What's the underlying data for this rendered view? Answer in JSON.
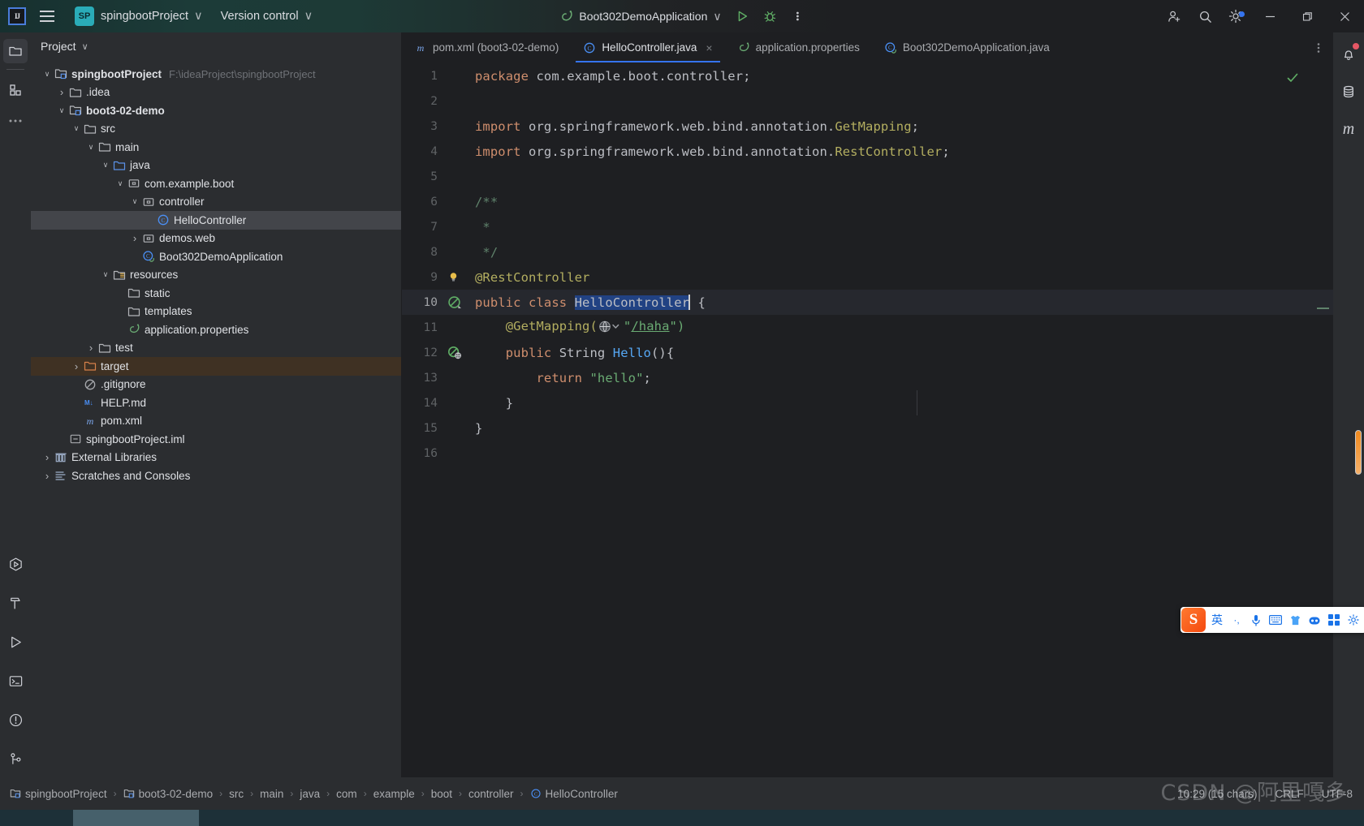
{
  "titlebar": {
    "logo_text": "IJ",
    "project_badge": "SP",
    "project_name": "spingbootProject",
    "version_control": "Version control",
    "run_config": "Boot302DemoApplication",
    "chevron": "∨"
  },
  "left_rail": {
    "items": [
      {
        "name": "project-tool-window",
        "icon": "folder-icon"
      },
      {
        "name": "commit-tool-window",
        "icon": "commit-icon"
      },
      {
        "name": "more-tool-windows",
        "icon": "ellipsis-icon"
      }
    ],
    "bottom_items": [
      {
        "name": "run-tool-window",
        "icon": "run-hex-icon"
      },
      {
        "name": "build-tool-window",
        "icon": "hammer-icon"
      },
      {
        "name": "services-tool-window",
        "icon": "play-icon"
      },
      {
        "name": "terminal-tool-window",
        "icon": "terminal-icon"
      },
      {
        "name": "problems-tool-window",
        "icon": "warning-icon"
      },
      {
        "name": "git-tool-window",
        "icon": "branch-icon"
      }
    ]
  },
  "right_rail": {
    "items": [
      {
        "name": "notifications",
        "icon": "bell-icon"
      },
      {
        "name": "database",
        "icon": "database-icon"
      },
      {
        "name": "maven",
        "icon": "maven-m-icon"
      }
    ]
  },
  "project_panel": {
    "title": "Project",
    "tree": [
      {
        "depth": 0,
        "arrow": "down",
        "icon": "module-icon",
        "label": "spingbootProject",
        "bold": true,
        "path": "F:\\ideaProject\\spingbootProject"
      },
      {
        "depth": 1,
        "arrow": "right",
        "icon": "folder-icon",
        "label": ".idea"
      },
      {
        "depth": 1,
        "arrow": "down",
        "icon": "module-icon",
        "label": "boot3-02-demo",
        "bold": true
      },
      {
        "depth": 2,
        "arrow": "down",
        "icon": "folder-icon",
        "label": "src"
      },
      {
        "depth": 3,
        "arrow": "down",
        "icon": "folder-icon",
        "label": "main"
      },
      {
        "depth": 4,
        "arrow": "down",
        "icon": "source-root-icon",
        "label": "java"
      },
      {
        "depth": 5,
        "arrow": "down",
        "icon": "package-icon",
        "label": "com.example.boot"
      },
      {
        "depth": 6,
        "arrow": "down",
        "icon": "package-icon",
        "label": "controller"
      },
      {
        "depth": 7,
        "arrow": "none",
        "icon": "java-class-icon",
        "label": "HelloController",
        "selected": true
      },
      {
        "depth": 6,
        "arrow": "right",
        "icon": "package-icon",
        "label": "demos.web"
      },
      {
        "depth": 6,
        "arrow": "none",
        "icon": "spring-class-icon",
        "label": "Boot302DemoApplication"
      },
      {
        "depth": 4,
        "arrow": "down",
        "icon": "resources-root-icon",
        "label": "resources"
      },
      {
        "depth": 5,
        "arrow": "none",
        "icon": "folder-icon",
        "label": "static"
      },
      {
        "depth": 5,
        "arrow": "none",
        "icon": "folder-icon",
        "label": "templates"
      },
      {
        "depth": 5,
        "arrow": "none",
        "icon": "spring-file-icon",
        "label": "application.properties"
      },
      {
        "depth": 3,
        "arrow": "right",
        "icon": "folder-icon",
        "label": "test"
      },
      {
        "depth": 2,
        "arrow": "right",
        "icon": "excluded-folder-icon",
        "label": "target",
        "highlight": true
      },
      {
        "depth": 2,
        "arrow": "none",
        "icon": "gitignore-icon",
        "label": ".gitignore"
      },
      {
        "depth": 2,
        "arrow": "none",
        "icon": "markdown-icon",
        "label": "HELP.md"
      },
      {
        "depth": 2,
        "arrow": "none",
        "icon": "maven-m-icon",
        "label": "pom.xml"
      },
      {
        "depth": 1,
        "arrow": "none",
        "icon": "iml-icon",
        "label": "spingbootProject.iml"
      },
      {
        "depth": 0,
        "arrow": "right",
        "icon": "library-icon",
        "label": "External Libraries"
      },
      {
        "depth": 0,
        "arrow": "right",
        "icon": "scratches-icon",
        "label": "Scratches and Consoles"
      }
    ]
  },
  "editor": {
    "tabs": [
      {
        "label": "pom.xml (boot3-02-demo)",
        "icon": "maven-m-icon",
        "active": false,
        "closable": false
      },
      {
        "label": "HelloController.java",
        "icon": "java-class-icon",
        "active": true,
        "closable": true,
        "close_glyph": "×"
      },
      {
        "label": "application.properties",
        "icon": "spring-file-icon",
        "active": false,
        "closable": false
      },
      {
        "label": "Boot302DemoApplication.java",
        "icon": "spring-class-icon",
        "active": false,
        "closable": false
      }
    ],
    "inspection_ok": true,
    "lines": [
      {
        "n": 1,
        "gutter": null,
        "segments": [
          {
            "t": "package ",
            "c": "kw"
          },
          {
            "t": "com.example.boot.controller;",
            "c": "plain"
          }
        ]
      },
      {
        "n": 2,
        "gutter": null,
        "segments": []
      },
      {
        "n": 3,
        "gutter": null,
        "segments": [
          {
            "t": "import ",
            "c": "kw"
          },
          {
            "t": "org.springframework.web.bind.annotation.",
            "c": "plain"
          },
          {
            "t": "GetMapping",
            "c": "ann"
          },
          {
            "t": ";",
            "c": "plain"
          }
        ]
      },
      {
        "n": 4,
        "gutter": null,
        "segments": [
          {
            "t": "import ",
            "c": "kw"
          },
          {
            "t": "org.springframework.web.bind.annotation.",
            "c": "plain"
          },
          {
            "t": "RestController",
            "c": "ann"
          },
          {
            "t": ";",
            "c": "plain"
          }
        ]
      },
      {
        "n": 5,
        "gutter": null,
        "segments": []
      },
      {
        "n": 6,
        "gutter": null,
        "segments": [
          {
            "t": "/**",
            "c": "cmt"
          }
        ]
      },
      {
        "n": 7,
        "gutter": null,
        "segments": [
          {
            "t": " *",
            "c": "cmt"
          }
        ]
      },
      {
        "n": 8,
        "gutter": null,
        "segments": [
          {
            "t": " */",
            "c": "cmt"
          }
        ]
      },
      {
        "n": 9,
        "gutter": "bulb",
        "segments": [
          {
            "t": "@RestController",
            "c": "ann"
          }
        ]
      },
      {
        "n": 10,
        "gutter": "bean",
        "current": true,
        "segments": [
          {
            "t": "public ",
            "c": "kw"
          },
          {
            "t": "class ",
            "c": "kw"
          },
          {
            "t": "HelloController",
            "c": "sel"
          },
          {
            "t": "caret",
            "c": "caret"
          },
          {
            "t": " {",
            "c": "plain"
          }
        ]
      },
      {
        "n": 11,
        "gutter": null,
        "segments": [
          {
            "t": "    @GetMapping(",
            "c": "ann"
          },
          {
            "t": "globe",
            "c": "globe"
          },
          {
            "t": "\"",
            "c": "str"
          },
          {
            "t": "/haha",
            "c": "urlstr"
          },
          {
            "t": "\")",
            "c": "str"
          }
        ]
      },
      {
        "n": 12,
        "gutter": "endpoint",
        "segments": [
          {
            "t": "    public ",
            "c": "kw"
          },
          {
            "t": "String ",
            "c": "plain"
          },
          {
            "t": "Hello",
            "c": "fn"
          },
          {
            "t": "(){",
            "c": "plain"
          }
        ]
      },
      {
        "n": 13,
        "gutter": null,
        "segments": [
          {
            "t": "        return ",
            "c": "kw"
          },
          {
            "t": "\"hello\"",
            "c": "str"
          },
          {
            "t": ";",
            "c": "plain"
          }
        ]
      },
      {
        "n": 14,
        "gutter": null,
        "segments": [
          {
            "t": "    }",
            "c": "plain"
          }
        ]
      },
      {
        "n": 15,
        "gutter": null,
        "segments": [
          {
            "t": "}",
            "c": "plain"
          }
        ]
      },
      {
        "n": 16,
        "gutter": null,
        "segments": []
      }
    ]
  },
  "breadcrumbs": [
    {
      "label": "spingbootProject",
      "icon": "module-icon"
    },
    {
      "label": "boot3-02-demo",
      "icon": "module-icon"
    },
    {
      "label": "src",
      "icon": null
    },
    {
      "label": "main",
      "icon": null
    },
    {
      "label": "java",
      "icon": null
    },
    {
      "label": "com",
      "icon": null
    },
    {
      "label": "example",
      "icon": null
    },
    {
      "label": "boot",
      "icon": null
    },
    {
      "label": "controller",
      "icon": null
    },
    {
      "label": "HelloController",
      "icon": "java-class-icon"
    }
  ],
  "status_bar": {
    "caret_position": "10:29 (15 chars)",
    "line_separator": "CRLF",
    "encoding": "UTF-8"
  },
  "watermark": "CSDN @阿里嘎多",
  "ime": {
    "logo": "S",
    "items": [
      "英",
      "·,",
      "mic-icon",
      "keyboard-icon",
      "skin-icon",
      "robot-icon",
      "apps-icon",
      "settings-icon"
    ]
  },
  "colors": {
    "accent": "#3574f0",
    "badge": "#2aacb8",
    "panel_bg": "#2b2d30",
    "editor_bg": "#1e1f22",
    "selection": "#214283",
    "target_highlight": "#3f3123",
    "string": "#6aab73",
    "keyword": "#cf8e6d",
    "annotation": "#b3ae60",
    "comment": "#5f826b",
    "method": "#56a8f5"
  }
}
